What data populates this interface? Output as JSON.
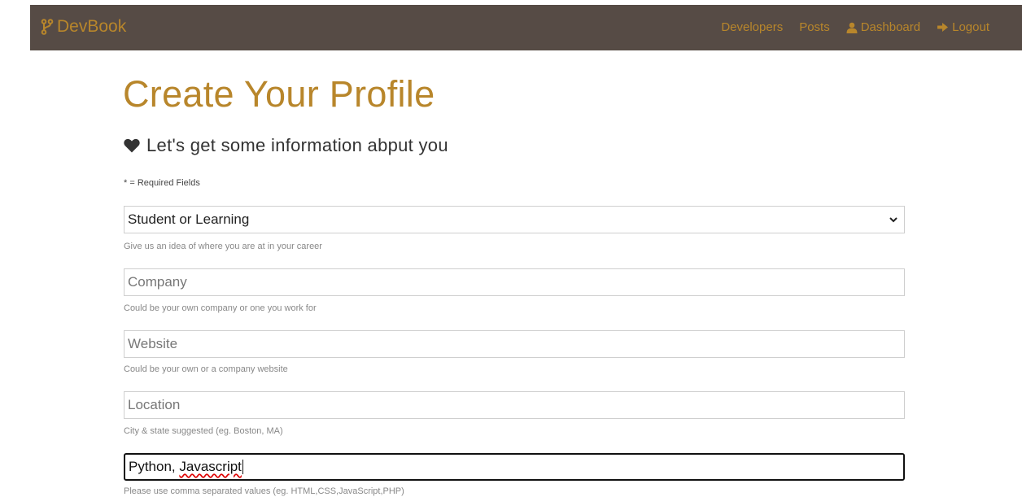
{
  "navbar": {
    "brand": "DevBook",
    "links": [
      "Developers",
      "Posts",
      "Dashboard",
      "Logout"
    ]
  },
  "page": {
    "title": "Create Your Profile",
    "lead": "Let's get some information abput you",
    "required_note": "* = Required Fields"
  },
  "form": {
    "status": {
      "value": "Student or Learning",
      "help": "Give us an idea of where you are at in your career"
    },
    "company": {
      "placeholder": "Company",
      "help": "Could be your own company or one you work for"
    },
    "website": {
      "placeholder": "Website",
      "help": "Could be your own or a company website"
    },
    "location": {
      "placeholder": "Location",
      "help": "City & state suggested (eg. Boston, MA)"
    },
    "skills": {
      "value_part1": "Python, ",
      "value_part2": "Javascript",
      "help": "Please use comma separated values (eg. HTML,CSS,JavaScript,PHP)"
    }
  },
  "colors": {
    "navbar_bg": "#564b45",
    "accent": "#b8862b"
  }
}
